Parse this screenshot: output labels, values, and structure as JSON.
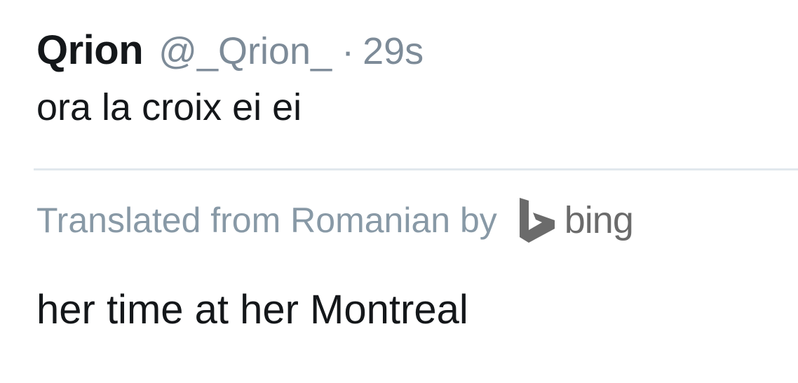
{
  "tweet": {
    "display_name": "Qrion",
    "handle": "@_Qrion_",
    "separator": "·",
    "timestamp": "29s",
    "text": "ora la croix ei ei"
  },
  "translation": {
    "label": "Translated from Romanian by",
    "provider_icon": "bing-logo-icon",
    "provider_name": "bing",
    "text": "her time at her Montreal"
  },
  "colors": {
    "text_primary": "#14171a",
    "text_secondary": "#8899a6",
    "divider": "#e1e8ed",
    "bing_logo": "#6b6b6b"
  }
}
